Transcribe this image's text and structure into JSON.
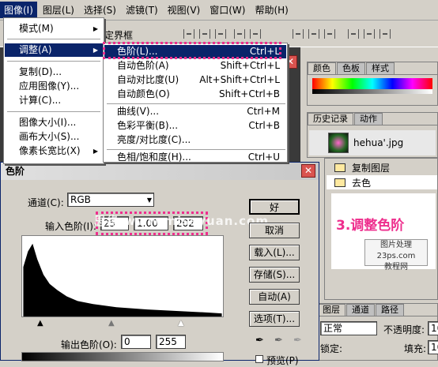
{
  "menubar": [
    "图像(I)",
    "图层(L)",
    "选择(S)",
    "滤镜(T)",
    "视图(V)",
    "窗口(W)",
    "帮助(H)"
  ],
  "toolbar": {
    "snippet": "定界框"
  },
  "image_menu": [
    {
      "label": "模式(M)",
      "arrow": true
    },
    {
      "label": "调整(A)",
      "arrow": true,
      "highlight": true
    },
    {
      "label": "复制(D)..."
    },
    {
      "label": "应用图像(Y)..."
    },
    {
      "label": "计算(C)..."
    },
    {
      "label": "图像大小(I)..."
    },
    {
      "label": "画布大小(S)..."
    },
    {
      "label": "像素长宽比(X)",
      "arrow": true
    }
  ],
  "adjust_menu": [
    {
      "label": "色阶(L)...",
      "shortcut": "Ctrl+L",
      "highlight": true
    },
    {
      "label": "自动色阶(A)",
      "shortcut": "Shift+Ctrl+L"
    },
    {
      "label": "自动对比度(U)",
      "shortcut": "Alt+Shift+Ctrl+L"
    },
    {
      "label": "自动颜色(O)",
      "shortcut": "Shift+Ctrl+B"
    },
    {
      "label": "曲线(V)...",
      "shortcut": "Ctrl+M"
    },
    {
      "label": "色彩平衡(B)...",
      "shortcut": "Ctrl+B"
    },
    {
      "label": "亮度/对比度(C)...",
      "shortcut": ""
    },
    {
      "label": "色相/饱和度(H)...",
      "shortcut": "Ctrl+U"
    }
  ],
  "color_panel": {
    "tabs": [
      "颜色",
      "色板",
      "样式"
    ]
  },
  "history_panel": {
    "tabs": [
      "历史记录",
      "动作"
    ],
    "item": "hehua'.jpg"
  },
  "actions_panel": {
    "items": [
      "复制图层",
      "去色"
    ],
    "annotation": "3.调整色阶",
    "logo_line1": "图片处理",
    "logo_line2": "23ps.com",
    "logo_line3": "教程网"
  },
  "layers_panel": {
    "tabs": [
      "图层",
      "通道",
      "路径"
    ],
    "mode": "正常",
    "opacity_label": "不透明度:",
    "opacity_value": "10",
    "lock_label": "锁定:",
    "fill_label": "填充:",
    "fill_value": "10"
  },
  "levels_dialog": {
    "title": "色阶",
    "channel_label": "通道(C):",
    "channel_value": "RGB",
    "input_label": "输入色阶(I):",
    "input_values": [
      "25",
      "1.00",
      "202"
    ],
    "output_label": "输出色阶(O):",
    "output_values": [
      "0",
      "255"
    ],
    "watermark": "思缘 www.missyuan.com",
    "buttons": [
      "好",
      "取消",
      "载入(L)...",
      "存储(S)...",
      "自动(A)",
      "选项(T)..."
    ],
    "preview_label": "预览(P)"
  },
  "colors": {
    "menu_highlight": "#0a246a",
    "annotation": "#ee2e8d"
  }
}
